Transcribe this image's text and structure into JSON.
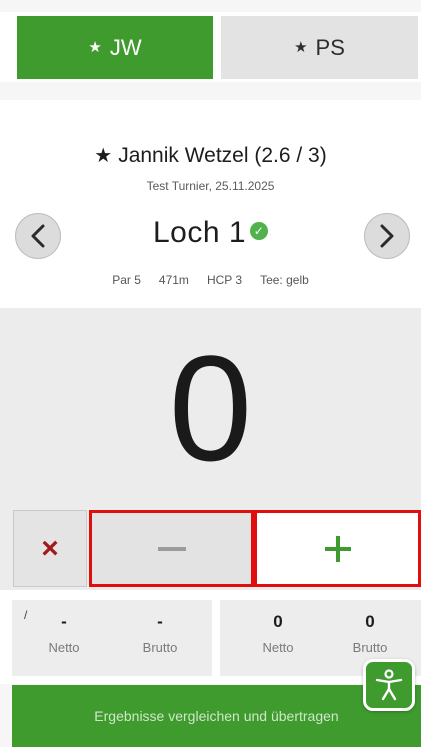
{
  "tabs": [
    {
      "star": "★",
      "label": "JW",
      "active": true
    },
    {
      "star": "★",
      "label": "PS",
      "active": false
    }
  ],
  "player": {
    "star": "★",
    "name": "Jannik Wetzel (2.6 / 3)",
    "tournament": "Test Turnier, 25.11.2025"
  },
  "hole": {
    "title": "Loch 1",
    "par": "Par 5",
    "length": "471m",
    "hcp": "HCP 3",
    "tee": "Tee: gelb"
  },
  "score": "0",
  "controls": {
    "clear": "×",
    "minus_icon": "minus-icon",
    "plus_icon": "plus-icon"
  },
  "summary": {
    "left": {
      "tick": "/",
      "netto_value": "-",
      "brutto_value": "-",
      "netto_label": "Netto",
      "brutto_label": "Brutto"
    },
    "right": {
      "netto_value": "0",
      "brutto_value": "0",
      "netto_label": "Netto",
      "brutto_label": "Brutto"
    }
  },
  "bottom_button": "Ergebnisse vergleichen und übertragen",
  "colors": {
    "accent_green": "#3f9b2e",
    "highlight_red": "#e10e0e",
    "clear_red": "#a11a1a",
    "check_green": "#4fb24a"
  }
}
